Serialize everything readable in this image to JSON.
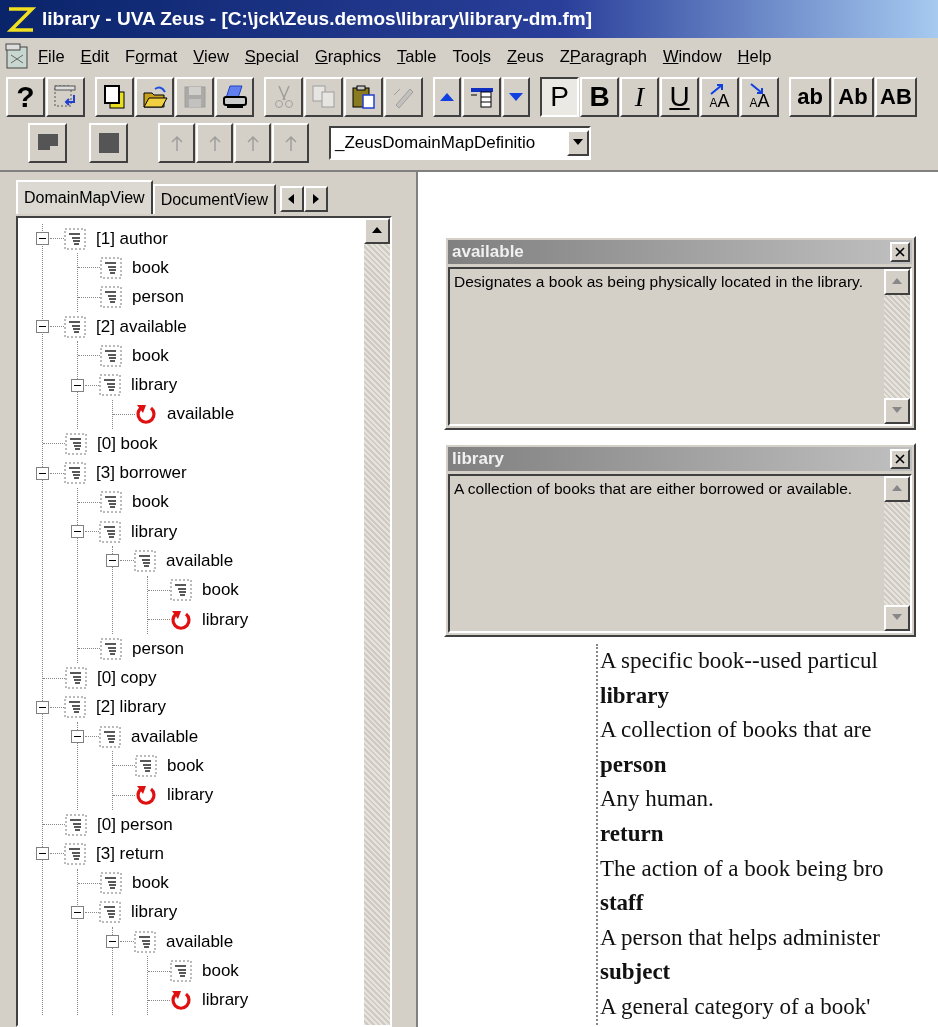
{
  "window": {
    "title": "library - UVA Zeus - [C:\\jck\\Zeus.demos\\library\\library-dm.fm]"
  },
  "menu": [
    {
      "key": "F",
      "after": "ile"
    },
    {
      "key": "E",
      "after": "dit"
    },
    {
      "before": "F",
      "key": "o",
      "after": "rmat"
    },
    {
      "key": "V",
      "after": "iew"
    },
    {
      "key": "S",
      "after": "pecial"
    },
    {
      "key": "G",
      "after": "raphics"
    },
    {
      "key": "T",
      "after": "able"
    },
    {
      "before": "Too",
      "key": "l",
      "after": "s"
    },
    {
      "key": "Z",
      "after": "eus"
    },
    {
      "before": "Z",
      "key": "P",
      "after": "aragraph"
    },
    {
      "key": "W",
      "after": "indow"
    },
    {
      "key": "H",
      "after": "elp"
    }
  ],
  "toolbar": [
    [
      {
        "kind": "help",
        "label": "?"
      },
      {
        "kind": "outline"
      }
    ],
    [
      {
        "kind": "new",
        "disabled": false
      },
      {
        "kind": "open",
        "disabled": false
      },
      {
        "kind": "save",
        "disabled": true
      },
      {
        "kind": "print",
        "disabled": false
      }
    ],
    [
      {
        "kind": "cut",
        "disabled": true
      },
      {
        "kind": "copy",
        "disabled": true
      },
      {
        "kind": "paste",
        "disabled": false
      },
      {
        "kind": "brush",
        "disabled": true
      }
    ],
    [
      {
        "kind": "up"
      },
      {
        "kind": "list"
      },
      {
        "kind": "down"
      }
    ],
    [
      {
        "kind": "plain",
        "label": "P",
        "pressed": true
      },
      {
        "kind": "bold",
        "label": "B",
        "pressed": false
      },
      {
        "kind": "italic",
        "label": "I",
        "pressed": false
      },
      {
        "kind": "underline",
        "label": "U",
        "pressed": false
      },
      {
        "kind": "raise",
        "label": "AA",
        "pressed": false
      },
      {
        "kind": "lower",
        "label": "AA",
        "pressed": false
      }
    ],
    [
      {
        "kind": "lowercase",
        "label": "ab",
        "pressed": false
      },
      {
        "kind": "titlecase",
        "label": "Ab",
        "pressed": false
      },
      {
        "kind": "uppercase",
        "label": "AB",
        "pressed": false
      }
    ]
  ],
  "format_bar": {
    "buttons": [
      {
        "kind": "para-left",
        "disabled": false
      },
      {
        "kind": "para-block",
        "disabled": false
      },
      {
        "kind": "promote",
        "disabled": true
      },
      {
        "kind": "promote",
        "disabled": true
      },
      {
        "kind": "promote",
        "disabled": true
      },
      {
        "kind": "promote",
        "disabled": true
      }
    ],
    "style_value": "_ZeusDomainMapDefinitio"
  },
  "left_panel": {
    "tabs": [
      {
        "label": "DomainMapView",
        "selected": true
      },
      {
        "label": "DocumentView",
        "selected": false
      }
    ],
    "tree": [
      {
        "label": "[1] author",
        "kind": "concept",
        "expanded": true,
        "children": [
          {
            "label": "book",
            "kind": "concept"
          },
          {
            "label": "person",
            "kind": "concept"
          }
        ]
      },
      {
        "label": "[2] available",
        "kind": "concept",
        "expanded": true,
        "children": [
          {
            "label": "book",
            "kind": "concept"
          },
          {
            "label": "library",
            "kind": "concept",
            "expanded": true,
            "children": [
              {
                "label": "available",
                "kind": "cycle"
              }
            ]
          }
        ]
      },
      {
        "label": "[0] book",
        "kind": "concept"
      },
      {
        "label": "[3] borrower",
        "kind": "concept",
        "expanded": true,
        "children": [
          {
            "label": "book",
            "kind": "concept"
          },
          {
            "label": "library",
            "kind": "concept",
            "expanded": true,
            "children": [
              {
                "label": "available",
                "kind": "concept",
                "expanded": true,
                "children": [
                  {
                    "label": "book",
                    "kind": "concept"
                  },
                  {
                    "label": "library",
                    "kind": "cycle"
                  }
                ]
              }
            ]
          },
          {
            "label": "person",
            "kind": "concept"
          }
        ]
      },
      {
        "label": "[0] copy",
        "kind": "concept"
      },
      {
        "label": "[2] library",
        "kind": "concept",
        "expanded": true,
        "children": [
          {
            "label": "available",
            "kind": "concept",
            "expanded": true,
            "children": [
              {
                "label": "book",
                "kind": "concept"
              },
              {
                "label": "library",
                "kind": "cycle"
              }
            ]
          }
        ]
      },
      {
        "label": "[0] person",
        "kind": "concept"
      },
      {
        "label": "[3] return",
        "kind": "concept",
        "expanded": true,
        "children": [
          {
            "label": "book",
            "kind": "concept"
          },
          {
            "label": "library",
            "kind": "concept",
            "expanded": true,
            "children": [
              {
                "label": "available",
                "kind": "concept",
                "expanded": true,
                "children": [
                  {
                    "label": "book",
                    "kind": "concept"
                  },
                  {
                    "label": "library",
                    "kind": "cycle"
                  }
                ]
              }
            ]
          }
        ]
      }
    ]
  },
  "popups": [
    {
      "title": "available",
      "text": "Designates a book as being physically located in the library."
    },
    {
      "title": "library",
      "text": "A collection of books that are either borrowed or available."
    }
  ],
  "document": {
    "entries": [
      {
        "kind": "definition",
        "text": "A specific book--used particul"
      },
      {
        "kind": "term",
        "text": "library"
      },
      {
        "kind": "definition",
        "text": "A collection of books that are"
      },
      {
        "kind": "term",
        "text": "person"
      },
      {
        "kind": "definition",
        "text": "Any human."
      },
      {
        "kind": "term",
        "text": "return"
      },
      {
        "kind": "definition",
        "text": "The action of a book being bro"
      },
      {
        "kind": "term",
        "text": "staff"
      },
      {
        "kind": "definition",
        "text": "A person that helps administer"
      },
      {
        "kind": "term",
        "text": "subject"
      },
      {
        "kind": "definition",
        "text": "A general category of a book'"
      }
    ]
  }
}
